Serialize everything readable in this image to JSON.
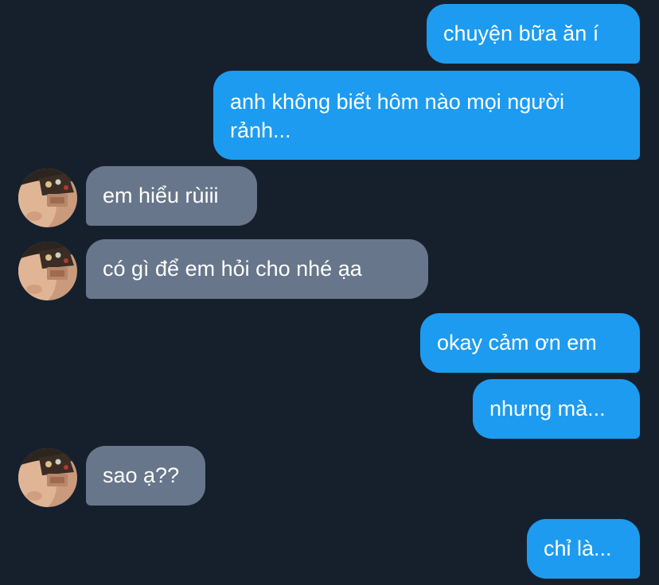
{
  "messages": [
    {
      "from": "me",
      "text": "chuyện bữa ăn í"
    },
    {
      "from": "me",
      "text": "anh không biết hôm nào mọi người rảnh..."
    },
    {
      "from": "them",
      "text": "em hiểu rùiii",
      "avatar_icon": "contact-avatar-icon"
    },
    {
      "from": "them",
      "text": "có gì để em hỏi cho nhé ạa",
      "avatar_icon": "contact-avatar-icon"
    },
    {
      "from": "me",
      "text": "okay cảm ơn em"
    },
    {
      "from": "me",
      "text": "nhưng mà..."
    },
    {
      "from": "them",
      "text": "sao ạ??",
      "avatar_icon": "contact-avatar-icon"
    },
    {
      "from": "me",
      "text": "chỉ là..."
    }
  ],
  "colors": {
    "background": "#16202d",
    "sent_bubble": "#1d9bf0",
    "received_bubble": "#67768a",
    "text": "#ffffff"
  }
}
